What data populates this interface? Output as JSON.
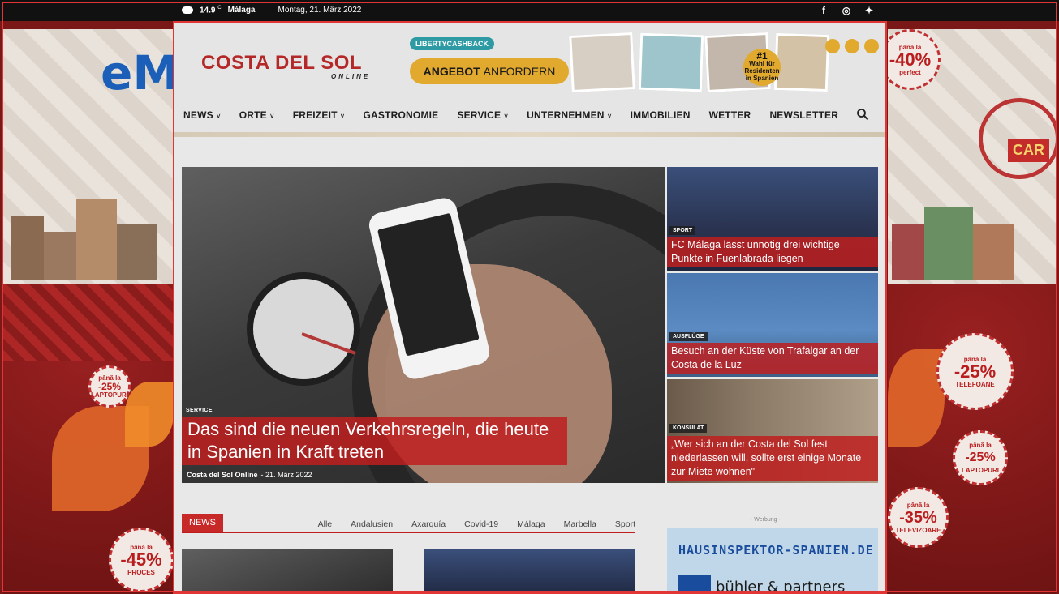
{
  "topbar": {
    "weather_icon": "cloud-icon",
    "temperature": "14.9",
    "temp_unit": "C",
    "city": "Málaga",
    "date": "Montag, 21. März 2022",
    "social": [
      "f",
      "◎",
      "✦"
    ]
  },
  "side_ads": {
    "left_logo": "eM",
    "left_badges": [
      {
        "top": "până la",
        "big": "-25%",
        "bottom": "LAPTOPURI"
      },
      {
        "top": "până la",
        "big": "-45%",
        "bottom": "PROCES"
      }
    ],
    "right_badges": [
      {
        "top": "până la",
        "big": "-40%",
        "bottom": "perfect"
      },
      {
        "top": "până la",
        "big": "-25%",
        "bottom": "TELEFOANE"
      },
      {
        "top": "până la",
        "big": "-25%",
        "bottom": "LAPTOPURI"
      },
      {
        "top": "până la",
        "big": "-35%",
        "bottom": "TELEVIZOARE"
      }
    ],
    "right_sign": "CAR"
  },
  "header": {
    "logo_main": "COSTA DEL SOL",
    "logo_sub": "ONLINE",
    "ad_tag": "LIBERTYCASHBACK",
    "ad_cta_bold": "ANGEBOT",
    "ad_cta_rest": "ANFORDERN",
    "ad_rank_num": "#1",
    "ad_rank_text": "Wahl für Residenten in Spanien"
  },
  "nav": {
    "items": [
      {
        "label": "NEWS",
        "dropdown": true
      },
      {
        "label": "ORTE",
        "dropdown": true
      },
      {
        "label": "FREIZEIT",
        "dropdown": true
      },
      {
        "label": "GASTRONOMIE",
        "dropdown": false
      },
      {
        "label": "SERVICE",
        "dropdown": true
      },
      {
        "label": "UNTERNEHMEN",
        "dropdown": true
      },
      {
        "label": "IMMOBILIEN",
        "dropdown": false
      },
      {
        "label": "WETTER",
        "dropdown": false
      },
      {
        "label": "NEWSLETTER",
        "dropdown": false
      }
    ],
    "search_icon": "search-icon"
  },
  "hero": {
    "category": "SERVICE",
    "title": "Das sind die neuen Verkehrsregeln, die heute in Spanien in Kraft treten",
    "author": "Costa del Sol Online",
    "date": "21. März 2022"
  },
  "side_articles": [
    {
      "category": "SPORT",
      "title": "FC Málaga lässt unnötig drei wichtige Punkte in Fuenlabrada liegen"
    },
    {
      "category": "AUSFLÜGE",
      "title": "Besuch an der Küste von Trafalgar an der Costa de la Luz"
    },
    {
      "category": "KONSULAT",
      "title": "„Wer sich an der Costa del Sol fest niederlassen will, sollte erst einige Monate zur Miete wohnen\""
    }
  ],
  "news": {
    "tag": "NEWS",
    "filters": [
      "Alle",
      "Andalusien",
      "Axarquía",
      "Covid-19",
      "Málaga",
      "Marbella",
      "Sport"
    ]
  },
  "ad_right": {
    "label": "- Werbung -",
    "domain": "HAUSINSPEKTOR-SPANIEN.DE",
    "company": "bühler & partners"
  }
}
